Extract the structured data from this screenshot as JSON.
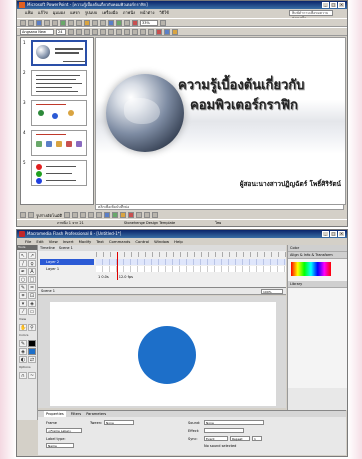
{
  "powerpoint": {
    "title": "Microsoft PowerPoint - [ความรู้เบื้องต้นเกี่ยวกับคอมพิวเตอร์กราฟิก]",
    "menu": [
      "แฟ้ม",
      "แก้ไข",
      "มุมมอง",
      "แทรก",
      "รูปแบบ",
      "เครื่องมือ",
      "ภาพนิ่ง",
      "หน้าต่าง",
      "วิธีใช้"
    ],
    "ask_placeholder": "พิมพ์คำถามเพื่อขอความช่วยเหลือ",
    "font_name": "Angsana New",
    "font_size": "24",
    "zoom": "33%",
    "slide_title_line1": "ความรู้เบื้องต้นเกี่ยวกับ",
    "slide_title_line2": "คอมพิวเตอร์กราฟิก",
    "slide_author": "ผู้สอน:นางสาวปฏิญฉัตร์  โพธิ์ศิริรัตน์",
    "thumb_numbers": [
      "1",
      "2",
      "3",
      "4",
      "5"
    ],
    "notes_placeholder": "คลิกเพื่อเพิ่มบันทึกย่อ",
    "draw_label": "รูปร่างอัตโนมัติ",
    "status": [
      "ภาพนิ่ง 1 จาก 21",
      "Stonehenge Design Template",
      "ไทย"
    ]
  },
  "flash": {
    "title": "Macromedia Flash Professional 8 - [Untitled-1*]",
    "menu": [
      "File",
      "Edit",
      "View",
      "Insert",
      "Modify",
      "Text",
      "Commands",
      "Control",
      "Window",
      "Help"
    ],
    "tools_label": "Tools",
    "view_label": "View",
    "colors_label": "Colors",
    "options_label": "Options",
    "timeline_tab": "Timeline",
    "scene_label": "Scene 1",
    "layers": [
      "Layer 2",
      "Layer 1"
    ],
    "zoom": "100%",
    "fps": "12.0 fps",
    "frame_info": "1   0.0s",
    "panels": {
      "color": "Color",
      "align": "Align & Info & Transform",
      "library": "Library"
    },
    "properties": {
      "tabs": [
        "Properties",
        "Filters",
        "Parameters"
      ],
      "frame_label": "Frame",
      "tween_label": "Tween:",
      "tween_value": "None",
      "sound_label": "Sound:",
      "sound_value": "None",
      "effect_label": "Effect:",
      "sync_label": "Sync:",
      "sync_value": "Event",
      "repeat_label": "Repeat",
      "repeat_count": "1",
      "frame_label_placeholder": "<Frame Label>",
      "label_type_label": "Label type:",
      "label_type_value": "Name",
      "no_sound": "No sound selected"
    },
    "circle_color": "#1d6fc9"
  }
}
